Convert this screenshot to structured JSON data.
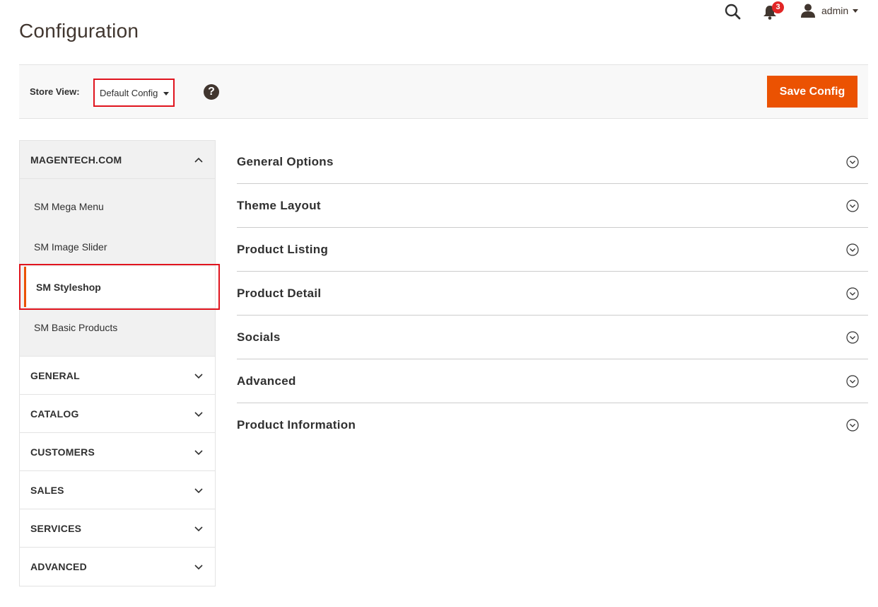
{
  "page": {
    "title": "Configuration"
  },
  "header": {
    "notifications_count": "3",
    "user_name": "admin"
  },
  "scope": {
    "label": "Store View:",
    "selected": "Default Config",
    "help": "?",
    "save_label": "Save Config"
  },
  "sidebar": {
    "open_group": {
      "title": "MAGENTECH.COM",
      "items": [
        {
          "label": "SM Mega Menu"
        },
        {
          "label": "SM Image Slider"
        },
        {
          "label": "SM Styleshop"
        },
        {
          "label": "SM Basic Products"
        }
      ]
    },
    "groups": [
      {
        "title": "GENERAL"
      },
      {
        "title": "CATALOG"
      },
      {
        "title": "CUSTOMERS"
      },
      {
        "title": "SALES"
      },
      {
        "title": "SERVICES"
      },
      {
        "title": "ADVANCED"
      }
    ]
  },
  "sections": [
    {
      "title": "General Options"
    },
    {
      "title": "Theme Layout"
    },
    {
      "title": "Product Listing"
    },
    {
      "title": "Product Detail"
    },
    {
      "title": "Socials"
    },
    {
      "title": "Advanced"
    },
    {
      "title": "Product Information"
    }
  ],
  "colors": {
    "accent": "#eb5202",
    "highlight_border": "#e0141e",
    "badge": "#e22626"
  }
}
